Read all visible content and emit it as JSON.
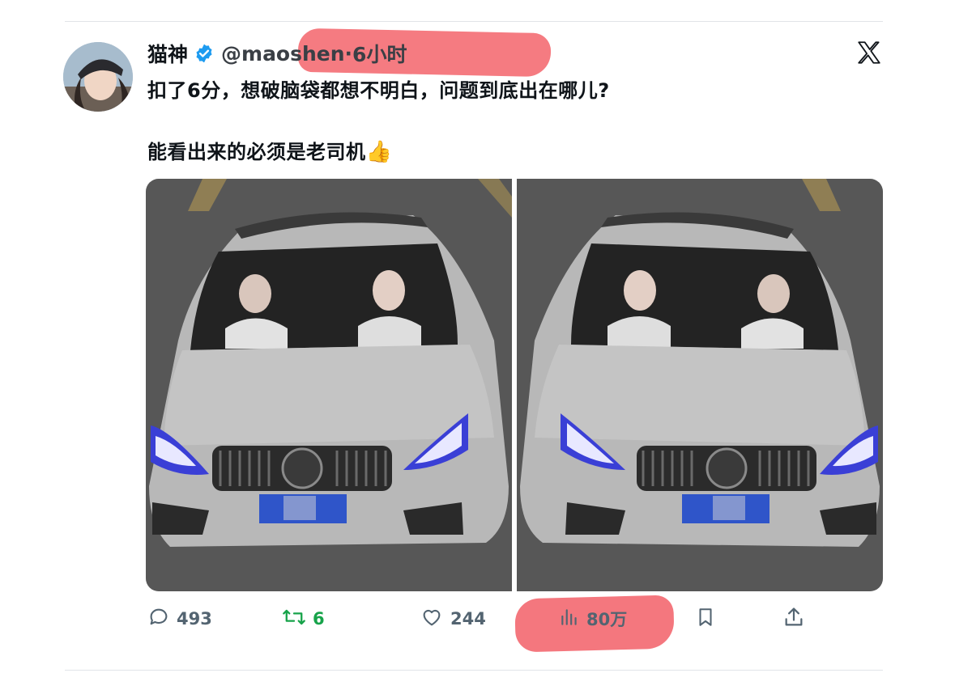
{
  "tweet": {
    "display_name": "猫神",
    "handle": "@maoshen",
    "separator": "·",
    "time": "6小时",
    "text_line1": "扣了6分，想破脑袋都想不明白，问题到底出在哪儿?",
    "text_line2": "能看出来的必须是老司机",
    "emoji": "👍"
  },
  "icons": {
    "verified": "verified-badge-icon",
    "platform": "x-logo-icon",
    "reply": "reply-icon",
    "retweet": "retweet-icon",
    "like": "heart-icon",
    "views": "views-bar-chart-icon",
    "bookmark": "bookmark-icon",
    "share": "share-icon"
  },
  "stats": {
    "replies": "493",
    "retweets": "6",
    "likes": "244",
    "views": "80万"
  },
  "colors": {
    "verified": "#1d9bf0",
    "retweet": "#17a34a",
    "muted": "#536471",
    "highlight": "#f2555d"
  }
}
